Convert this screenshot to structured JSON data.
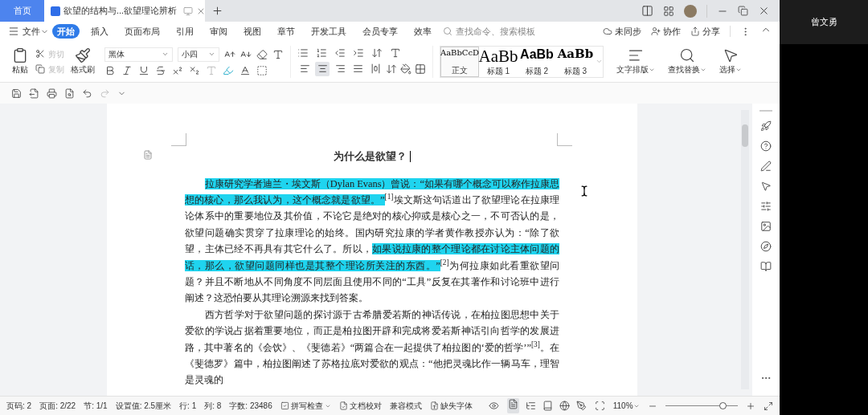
{
  "tabs": [
    {
      "label": "首页",
      "kind": "home",
      "selected": false
    },
    {
      "label": "欲望的结构与...欲望理论辨析",
      "kind": "document",
      "selected": true
    }
  ],
  "menu": {
    "file": "文件",
    "items": [
      {
        "label": "开始",
        "selected": true
      },
      {
        "label": "插入",
        "selected": false
      },
      {
        "label": "页面布局",
        "selected": false
      },
      {
        "label": "引用",
        "selected": false
      },
      {
        "label": "审阅",
        "selected": false
      },
      {
        "label": "视图",
        "selected": false
      },
      {
        "label": "章节",
        "selected": false
      },
      {
        "label": "开发工具",
        "selected": false
      },
      {
        "label": "会员专享",
        "selected": false
      },
      {
        "label": "效率",
        "selected": false
      }
    ],
    "search_placeholder": "查找命令、搜索模板",
    "actions": [
      "未同步",
      "协作",
      "分享"
    ]
  },
  "ribbon": {
    "paste": "粘贴",
    "cut": {
      "label": "剪切",
      "disabled": true
    },
    "copy": {
      "label": "复制",
      "disabled": true
    },
    "format_painter": "格式刷",
    "font_name": "黑体",
    "font_size": "小四",
    "alignments": [
      {
        "selected": false
      },
      {
        "selected": true
      },
      {
        "selected": false
      },
      {
        "selected": false
      },
      {
        "selected": false
      }
    ],
    "styles": [
      {
        "preview": "AaBbCcD",
        "label": "正文",
        "selected": true
      },
      {
        "preview": "AaBb",
        "label": "标题 1",
        "selected": false
      },
      {
        "preview": "AaBb",
        "label": "标题 2",
        "selected": false
      },
      {
        "preview": "AaBb",
        "label": "标题 3",
        "selected": false
      }
    ],
    "tools": [
      "文字排版",
      "查找替换",
      "选择"
    ]
  },
  "document": {
    "title": "为什么是欲望？",
    "paragraphs": [
      [
        {
          "text": "拉康研究学者迪兰・埃文斯（Dylan Evans）曾说：“如果有哪个概念可以称作拉康思想的核心，那么我认为，这个概念就是欲望。”",
          "highlighted": true
        },
        {
          "text": "$^{[1]}$埃文斯这句话道出了欲望理论在拉康理论体系中的重要地位及其价值，不论它是绝对的核心抑或是核心之一，不可否认的是，欲望问题确实贯穿了拉康理论的始终。国内研究拉康的学者黄作教授亦认为：“除了欲望，主体已经不再具有其它什么了。所以，",
          "highlighted": false
        },
        {
          "text": "如果说拉康的整个理论都在讨论主体问题的话，那么，欲望问题同样也是其整个理论所关注的东西。”",
          "highlighted": true
        },
        {
          "text": "$^{[2]}$为何拉康如此看重欲望问题？并且不断地从不同角度不同层面且使用不同的“工具”反复在其著作和讨论班中进行阐述？这恐怕要从其理论溯源来找到答案。",
          "highlighted": false
        }
      ],
      [
        {
          "text": "西方哲学对于欲望问题的探讨源于古希腊爱若斯的神话传说，在柏拉图思想中关于爱欲的学说占据着重要地位，而正是柏拉图开辟和完成将爱若斯神话引向哲学的发展进路，其中著名的《会饮》、《斐德若》“两篇合在一起提供了柏拉图的‘爱的哲学’”$^{[3]}$。在《斐德罗》篇中，柏拉图阐述了苏格拉底对爱欲的观点：“他把灵魂比作一辆马车，理智是灵魂的",
          "highlighted": false
        }
      ]
    ]
  },
  "status_bar": {
    "fields": [
      "页码: 2",
      "页面: 2/22",
      "节: 1/1",
      "设置值: 2.5厘米",
      "行: 1",
      "列: 8",
      "字数: 23486"
    ],
    "spell_check": "拼写检查",
    "proofread": "文档校对",
    "compat_mode": "兼容模式",
    "missing_fonts": "缺失字体",
    "zoom": "110%",
    "zoom_slider": {
      "level": 0.8
    }
  },
  "participant": {
    "name": "曾文勇"
  }
}
